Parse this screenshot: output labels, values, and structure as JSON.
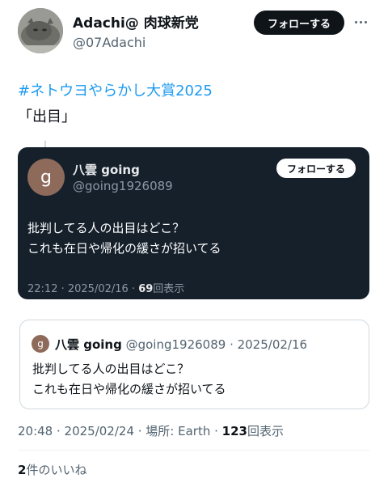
{
  "author": {
    "display_name": "Adachi@ 肉球新党",
    "handle": "@07Adachi",
    "follow_label": "フォローする"
  },
  "tweet": {
    "hashtag": "#ネトウヨやらかし大賞2025",
    "text": "「出目」"
  },
  "embedded_image": {
    "avatar_letter": "g",
    "name": "八雲 going",
    "handle": "@going1926089",
    "follow_label": "フォローする",
    "line1": "批判してる人の出目はどこ？",
    "line2": "これも在日や帰化の緩さが招いてる",
    "timestamp": "22:12 · 2025/02/16 · ",
    "views_count": "69",
    "views_label": "回表示"
  },
  "quote": {
    "avatar_letter": "g",
    "name": "八雲 going",
    "meta": " @going1926089 · 2025/02/16",
    "line1": "批判してる人の出目はどこ？",
    "line2": "これも在日や帰化の緩さが招いてる"
  },
  "meta": {
    "timestamp": "20:48 · 2025/02/24 · 場所: Earth · ",
    "views_count": "123",
    "views_label": "回表示"
  },
  "likes": {
    "count": "2",
    "label": "件のいいね"
  },
  "colors": {
    "link": "#1d9bf0",
    "dark_card": "#15202b"
  },
  "icons": [
    "more-icon"
  ]
}
